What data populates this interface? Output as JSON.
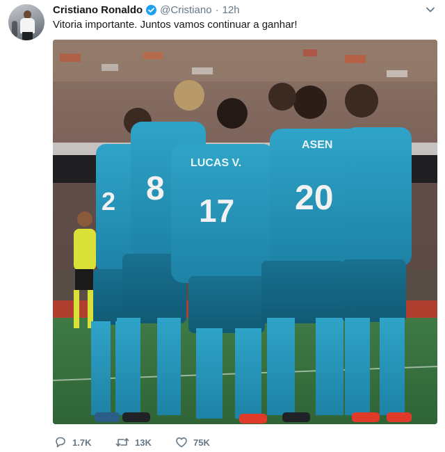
{
  "tweet": {
    "author_name": "Cristiano Ronaldo",
    "handle": "@Cristiano",
    "separator": "·",
    "time": "12h",
    "text": "Vitoria importante. Juntos vamos continuar a ganhar!",
    "photo": {
      "jersey_numbers": [
        "2",
        "8",
        "17",
        "20"
      ],
      "jersey_names": [
        "LUCAS V.",
        "ASEN"
      ],
      "jersey_color": "#2b9cc0"
    }
  },
  "actions": {
    "reply_count": "1.7K",
    "retweet_count": "13K",
    "like_count": "75K"
  },
  "icons": {
    "verified": "verified-badge-icon",
    "caret": "chevron-down-icon",
    "reply": "reply-icon",
    "retweet": "retweet-icon",
    "like": "heart-icon"
  },
  "colors": {
    "brand_blue": "#1da1f2",
    "muted_text": "#657786",
    "primary_text": "#14171a"
  }
}
